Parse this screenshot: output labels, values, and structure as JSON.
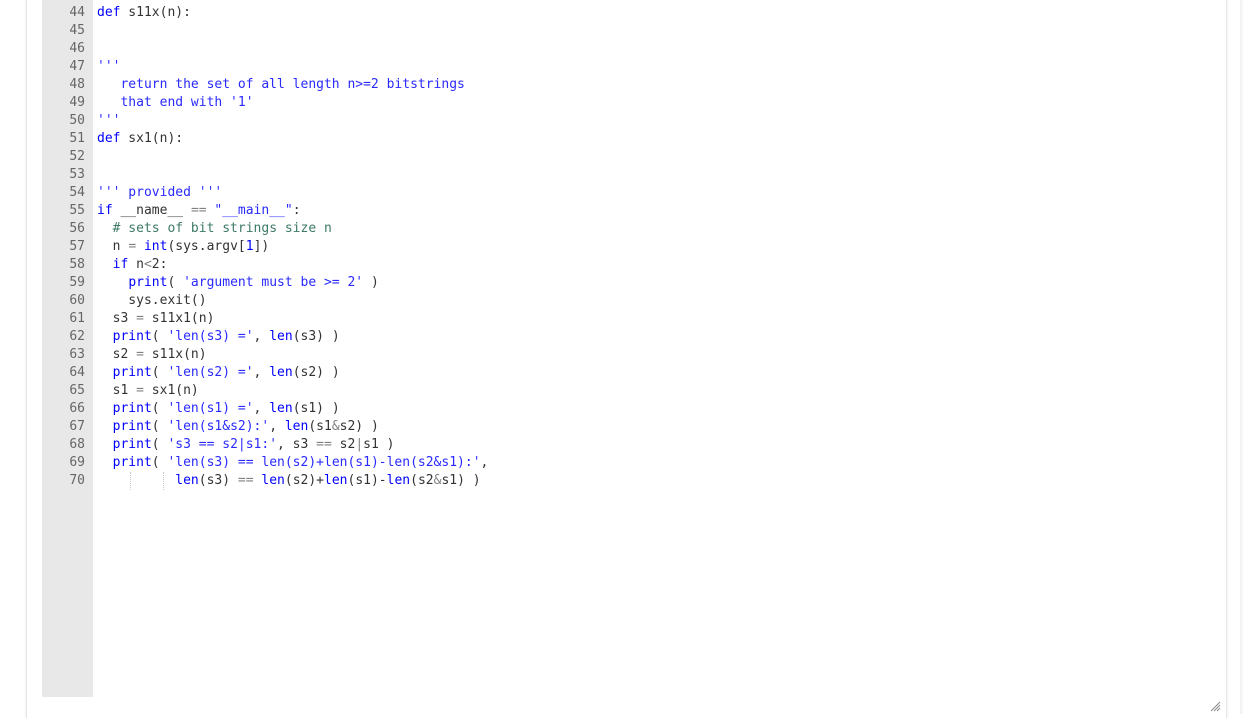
{
  "editor": {
    "language": "python",
    "first_line": 44,
    "lines": [
      {
        "n": "44",
        "tokens": [
          [
            "kw",
            "def"
          ],
          [
            "plain",
            " s11x(n):"
          ]
        ]
      },
      {
        "n": "45",
        "tokens": []
      },
      {
        "n": "46",
        "tokens": []
      },
      {
        "n": "47",
        "tokens": [
          [
            "str",
            "'''"
          ]
        ]
      },
      {
        "n": "48",
        "tokens": [
          [
            "str",
            "   return the set of all length n>=2 bitstrings"
          ]
        ]
      },
      {
        "n": "49",
        "tokens": [
          [
            "str",
            "   that end with '1'"
          ]
        ]
      },
      {
        "n": "50",
        "tokens": [
          [
            "str",
            "'''"
          ]
        ]
      },
      {
        "n": "51",
        "tokens": [
          [
            "kw",
            "def"
          ],
          [
            "plain",
            " sx1(n):"
          ]
        ]
      },
      {
        "n": "52",
        "tokens": []
      },
      {
        "n": "53",
        "tokens": []
      },
      {
        "n": "54",
        "tokens": [
          [
            "str",
            "''' provided '''"
          ]
        ]
      },
      {
        "n": "55",
        "tokens": [
          [
            "kw",
            "if"
          ],
          [
            "plain",
            " __name__ "
          ],
          [
            "op",
            "=="
          ],
          [
            "plain",
            " "
          ],
          [
            "str",
            "\"__main__\""
          ],
          [
            "plain",
            ":"
          ]
        ]
      },
      {
        "n": "56",
        "tokens": [
          [
            "plain",
            "  "
          ],
          [
            "com",
            "# sets of bit strings size n"
          ]
        ]
      },
      {
        "n": "57",
        "tokens": [
          [
            "plain",
            "  n "
          ],
          [
            "op",
            "="
          ],
          [
            "plain",
            " "
          ],
          [
            "builtin",
            "int"
          ],
          [
            "plain",
            "(sys.argv["
          ],
          [
            "num",
            "1"
          ],
          [
            "plain",
            "])"
          ]
        ]
      },
      {
        "n": "58",
        "tokens": [
          [
            "plain",
            "  "
          ],
          [
            "kw",
            "if"
          ],
          [
            "plain",
            " n"
          ],
          [
            "op",
            "<"
          ],
          [
            "plain",
            "2:"
          ]
        ]
      },
      {
        "n": "59",
        "tokens": [
          [
            "plain",
            "    "
          ],
          [
            "builtin",
            "print"
          ],
          [
            "plain",
            "( "
          ],
          [
            "str",
            "'argument must be >= 2'"
          ],
          [
            "plain",
            " )"
          ]
        ]
      },
      {
        "n": "60",
        "tokens": [
          [
            "plain",
            "    sys.exit()"
          ]
        ]
      },
      {
        "n": "61",
        "tokens": [
          [
            "plain",
            "  s3 "
          ],
          [
            "op",
            "="
          ],
          [
            "plain",
            " s11x1(n)"
          ]
        ]
      },
      {
        "n": "62",
        "tokens": [
          [
            "plain",
            "  "
          ],
          [
            "builtin",
            "print"
          ],
          [
            "plain",
            "( "
          ],
          [
            "str",
            "'len(s3) ='"
          ],
          [
            "plain",
            ", "
          ],
          [
            "builtin",
            "len"
          ],
          [
            "plain",
            "(s3) )"
          ]
        ]
      },
      {
        "n": "63",
        "tokens": [
          [
            "plain",
            "  s2 "
          ],
          [
            "op",
            "="
          ],
          [
            "plain",
            " s11x(n)"
          ]
        ]
      },
      {
        "n": "64",
        "tokens": [
          [
            "plain",
            "  "
          ],
          [
            "builtin",
            "print"
          ],
          [
            "plain",
            "( "
          ],
          [
            "str",
            "'len(s2) ='"
          ],
          [
            "plain",
            ", "
          ],
          [
            "builtin",
            "len"
          ],
          [
            "plain",
            "(s2) )"
          ]
        ]
      },
      {
        "n": "65",
        "tokens": [
          [
            "plain",
            "  s1 "
          ],
          [
            "op",
            "="
          ],
          [
            "plain",
            " sx1(n)"
          ]
        ]
      },
      {
        "n": "66",
        "tokens": [
          [
            "plain",
            "  "
          ],
          [
            "builtin",
            "print"
          ],
          [
            "plain",
            "( "
          ],
          [
            "str",
            "'len(s1) ='"
          ],
          [
            "plain",
            ", "
          ],
          [
            "builtin",
            "len"
          ],
          [
            "plain",
            "(s1) )"
          ]
        ]
      },
      {
        "n": "67",
        "tokens": [
          [
            "plain",
            "  "
          ],
          [
            "builtin",
            "print"
          ],
          [
            "plain",
            "( "
          ],
          [
            "str",
            "'len(s1&s2):'"
          ],
          [
            "plain",
            ", "
          ],
          [
            "builtin",
            "len"
          ],
          [
            "plain",
            "(s1"
          ],
          [
            "op",
            "&"
          ],
          [
            "plain",
            "s2) )"
          ]
        ]
      },
      {
        "n": "68",
        "tokens": [
          [
            "plain",
            "  "
          ],
          [
            "builtin",
            "print"
          ],
          [
            "plain",
            "( "
          ],
          [
            "str",
            "'s3 == s2|s1:'"
          ],
          [
            "plain",
            ", s3 "
          ],
          [
            "op",
            "=="
          ],
          [
            "plain",
            " s2"
          ],
          [
            "op",
            "|"
          ],
          [
            "plain",
            "s1 )"
          ]
        ]
      },
      {
        "n": "69",
        "tokens": [
          [
            "plain",
            "  "
          ],
          [
            "builtin",
            "print"
          ],
          [
            "plain",
            "( "
          ],
          [
            "str",
            "'len(s3) == len(s2)+len(s1)-len(s2&s1):'"
          ],
          [
            "plain",
            ","
          ]
        ]
      },
      {
        "n": "70",
        "tokens": [
          [
            "plain",
            "          "
          ],
          [
            "builtin",
            "len"
          ],
          [
            "plain",
            "(s3) "
          ],
          [
            "op",
            "=="
          ],
          [
            "plain",
            " "
          ],
          [
            "builtin",
            "len"
          ],
          [
            "plain",
            "(s2)+"
          ],
          [
            "builtin",
            "len"
          ],
          [
            "plain",
            "(s1)-"
          ],
          [
            "builtin",
            "len"
          ],
          [
            "plain",
            "(s2"
          ],
          [
            "op",
            "&"
          ],
          [
            "plain",
            "s1) )"
          ]
        ]
      }
    ]
  },
  "icons": {
    "resize_grip": "resize-grip-icon"
  },
  "colors": {
    "keyword": "#0000ff",
    "string": "#2a2aff",
    "comment": "#3d7a64",
    "identifier": "#333333",
    "operator": "#808080",
    "gutter_bg": "#e8e8e8",
    "line_number": "#666666"
  }
}
